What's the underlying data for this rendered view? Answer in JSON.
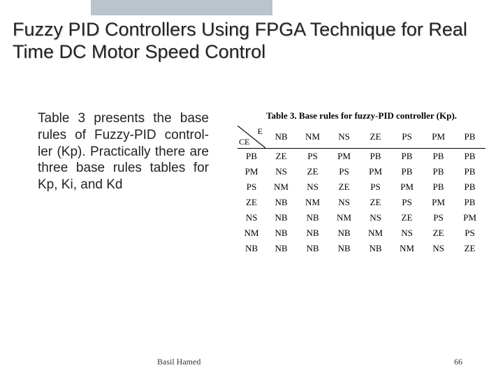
{
  "title": "Fuzzy PID Controllers Using FPGA Technique for Real Time DC Motor Speed Control",
  "body": "Table 3 presents the base rules of Fuzzy-PID control-        ler      (Kp). Practically there are three base rules tables for Kp, Ki, and Kd",
  "table": {
    "caption": "Table 3. Base rules for fuzzy-PID controller (Kp).",
    "col_axis": "E",
    "row_axis": "CE",
    "columns": [
      "NB",
      "NM",
      "NS",
      "ZE",
      "PS",
      "PM",
      "PB"
    ],
    "rows": [
      {
        "label": "PB",
        "cells": [
          "ZE",
          "PS",
          "PM",
          "PB",
          "PB",
          "PB",
          "PB"
        ]
      },
      {
        "label": "PM",
        "cells": [
          "NS",
          "ZE",
          "PS",
          "PM",
          "PB",
          "PB",
          "PB"
        ]
      },
      {
        "label": "PS",
        "cells": [
          "NM",
          "NS",
          "ZE",
          "PS",
          "PM",
          "PB",
          "PB"
        ]
      },
      {
        "label": "ZE",
        "cells": [
          "NB",
          "NM",
          "NS",
          "ZE",
          "PS",
          "PM",
          "PB"
        ]
      },
      {
        "label": "NS",
        "cells": [
          "NB",
          "NB",
          "NM",
          "NS",
          "ZE",
          "PS",
          "PM"
        ]
      },
      {
        "label": "NM",
        "cells": [
          "NB",
          "NB",
          "NB",
          "NM",
          "NS",
          "ZE",
          "PS"
        ]
      },
      {
        "label": "NB",
        "cells": [
          "NB",
          "NB",
          "NB",
          "NB",
          "NM",
          "NS",
          "ZE"
        ]
      }
    ]
  },
  "footer": {
    "author": "Basil Hamed",
    "page": "66"
  }
}
